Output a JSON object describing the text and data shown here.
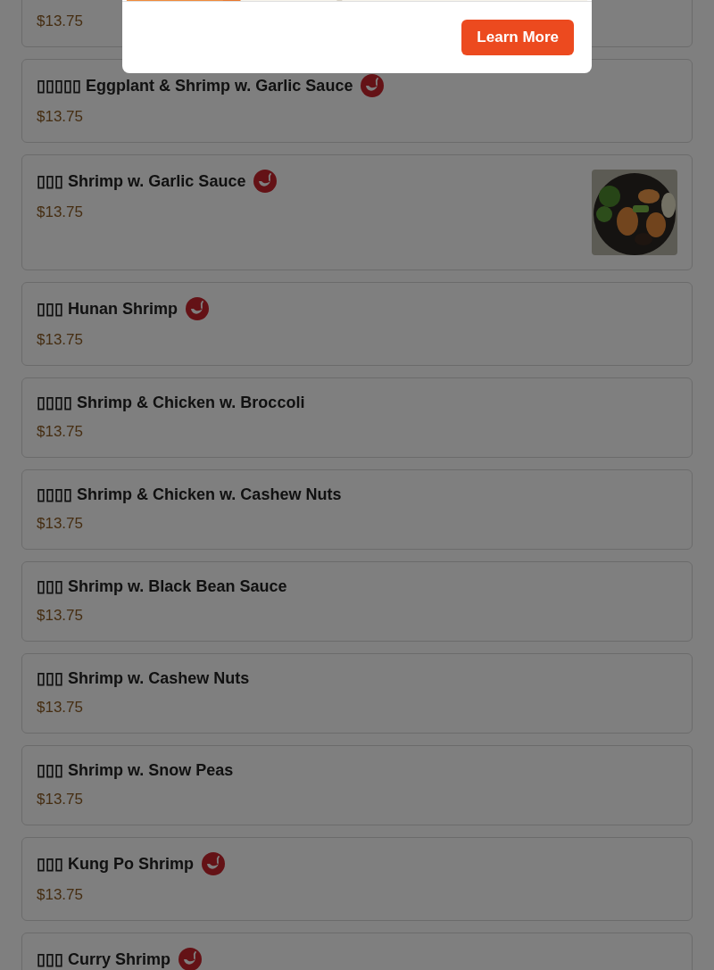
{
  "modal": {
    "button": "Learn More"
  },
  "items": [
    {
      "price": "$13.75",
      "spicy": false,
      "photo": false
    },
    {
      "name": "▯▯▯▯▯ Eggplant & Shrimp w. Garlic Sauce",
      "price": "$13.75",
      "spicy": true,
      "photo": false
    },
    {
      "name": "▯▯▯ Shrimp w. Garlic Sauce",
      "price": "$13.75",
      "spicy": true,
      "photo": true
    },
    {
      "name": "▯▯▯ Hunan Shrimp",
      "price": "$13.75",
      "spicy": true,
      "photo": false
    },
    {
      "name": "▯▯▯▯ Shrimp & Chicken w. Broccoli",
      "price": "$13.75",
      "spicy": false,
      "photo": false
    },
    {
      "name": "▯▯▯▯ Shrimp & Chicken w. Cashew Nuts",
      "price": "$13.75",
      "spicy": false,
      "photo": false
    },
    {
      "name": "▯▯▯ Shrimp w. Black Bean Sauce",
      "price": "$13.75",
      "spicy": false,
      "photo": false
    },
    {
      "name": "▯▯▯ Shrimp w. Cashew Nuts",
      "price": "$13.75",
      "spicy": false,
      "photo": false
    },
    {
      "name": "▯▯▯ Shrimp w. Snow Peas",
      "price": "$13.75",
      "spicy": false,
      "photo": false
    },
    {
      "name": "▯▯▯ Kung Po Shrimp",
      "price": "$13.75",
      "spicy": true,
      "photo": false
    },
    {
      "name": "▯▯▯ Curry Shrimp",
      "spicy": true,
      "photo": false
    }
  ]
}
